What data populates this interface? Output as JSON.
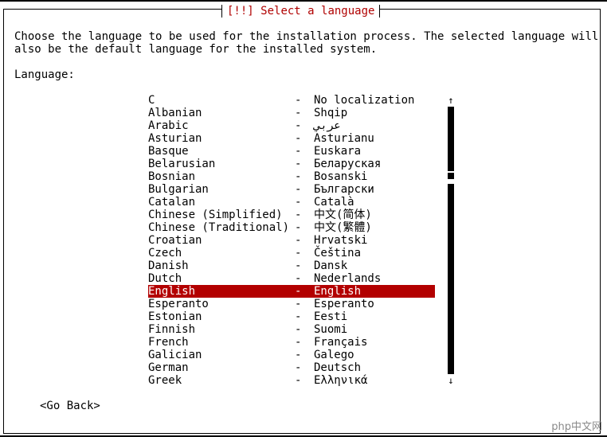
{
  "dialog": {
    "title_prefix": "[!!]",
    "title_text": "Select a language",
    "intro": "Choose the language to be used for the installation process. The selected language will\nalso be the default language for the installed system.",
    "language_label": "Language:",
    "go_back": "<Go Back>"
  },
  "languages": [
    {
      "name": "C",
      "native": "No localization"
    },
    {
      "name": "Albanian",
      "native": "Shqip"
    },
    {
      "name": "Arabic",
      "native": "عربي"
    },
    {
      "name": "Asturian",
      "native": "Asturianu"
    },
    {
      "name": "Basque",
      "native": "Euskara"
    },
    {
      "name": "Belarusian",
      "native": "Беларуская"
    },
    {
      "name": "Bosnian",
      "native": "Bosanski"
    },
    {
      "name": "Bulgarian",
      "native": "Български"
    },
    {
      "name": "Catalan",
      "native": "Català"
    },
    {
      "name": "Chinese (Simplified)",
      "native": "中文(简体)"
    },
    {
      "name": "Chinese (Traditional)",
      "native": "中文(繁體)"
    },
    {
      "name": "Croatian",
      "native": "Hrvatski"
    },
    {
      "name": "Czech",
      "native": "Čeština"
    },
    {
      "name": "Danish",
      "native": "Dansk"
    },
    {
      "name": "Dutch",
      "native": "Nederlands"
    },
    {
      "name": "English",
      "native": "English",
      "selected": true
    },
    {
      "name": "Esperanto",
      "native": "Esperanto"
    },
    {
      "name": "Estonian",
      "native": "Eesti"
    },
    {
      "name": "Finnish",
      "native": "Suomi"
    },
    {
      "name": "French",
      "native": "Français"
    },
    {
      "name": "Galician",
      "native": "Galego"
    },
    {
      "name": "German",
      "native": "Deutsch"
    },
    {
      "name": "Greek",
      "native": "Ελληνικά"
    }
  ],
  "separator": "-",
  "scrollbar": {
    "up_arrow": "↑",
    "down_arrow": "↓"
  },
  "colors": {
    "accent": "#b30000",
    "background": "#ffffff",
    "text": "#000000"
  },
  "watermark": "php中文网"
}
